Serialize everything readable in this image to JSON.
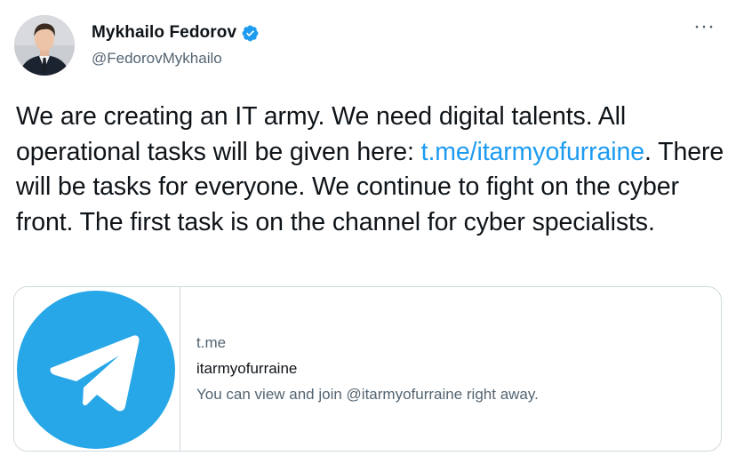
{
  "author": {
    "display_name": "Mykhailo Fedorov",
    "handle": "@FedorovMykhailo",
    "verified": true,
    "avatar_icon": "profile-photo",
    "more_icon": "more-horizontal-icon",
    "more_label": "···"
  },
  "tweet": {
    "text_part1": "We are creating an IT army. We need digital talents. All operational tasks will be given here: ",
    "link_text": "t.me/itarmyofurraine",
    "text_part2": ". There will be tasks for everyone. We continue to fight on the cyber front. The first task is on the channel for cyber specialists."
  },
  "card": {
    "domain": "t.me",
    "title": "itarmyofurraine",
    "description": "You can view and join @itarmyofurraine right away.",
    "media_icon": "telegram-logo"
  },
  "colors": {
    "link": "#1d9bf0",
    "verified": "#1d9bf0",
    "telegram": "#27a7e7",
    "text": "#0f1419",
    "secondary": "#536471",
    "border": "#cfd9de"
  }
}
